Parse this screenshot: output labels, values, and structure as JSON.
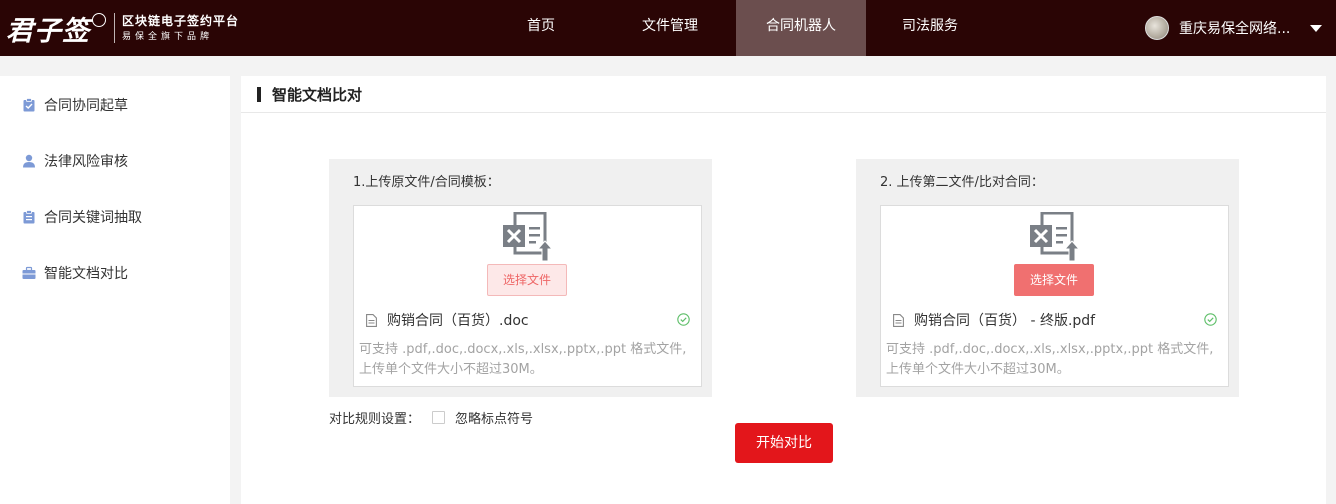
{
  "header": {
    "logo_main": "君子签",
    "logo_line1": "区块链电子签约平台",
    "logo_line2": "易保全旗下品牌",
    "nav": [
      {
        "label": "首页",
        "active": false
      },
      {
        "label": "文件管理",
        "active": false
      },
      {
        "label": "合同机器人",
        "active": true
      },
      {
        "label": "司法服务",
        "active": false
      }
    ],
    "user_name": "重庆易保全网络..."
  },
  "sidebar": {
    "items": [
      {
        "label": "合同协同起草",
        "icon": "clipboard-check-icon"
      },
      {
        "label": "法律风险审核",
        "icon": "person-icon"
      },
      {
        "label": "合同关键词抽取",
        "icon": "clipboard-list-icon"
      },
      {
        "label": "智能文档对比",
        "icon": "briefcase-icon"
      }
    ]
  },
  "main": {
    "title": "智能文档比对",
    "panels": [
      {
        "label": "1.上传原文件/合同模板：",
        "button_label": "选择文件",
        "file_name": "购销合同（百货）.doc",
        "hint": "可支持 .pdf,.doc,.docx,.xls,.xlsx,.pptx,.ppt 格式文件,上传单个文件大小不超过30M。"
      },
      {
        "label": "2. 上传第二文件/比对合同：",
        "button_label": "选择文件",
        "file_name": "购销合同（百货） - 终版.pdf",
        "hint": "可支持 .pdf,.doc,.docx,.xls,.xlsx,.pptx,.ppt 格式文件,上传单个文件大小不超过30M。"
      }
    ],
    "rule_label": "对比规则设置：",
    "rule_option": "忽略标点符号",
    "start_button": "开始对比"
  },
  "colors": {
    "header_bg": "#2a0505",
    "nav_active_bg": "#6b4e4e",
    "accent_red": "#e3161b",
    "sidebar_icon": "#7d9ad6",
    "success_green": "#5fbf6a"
  }
}
